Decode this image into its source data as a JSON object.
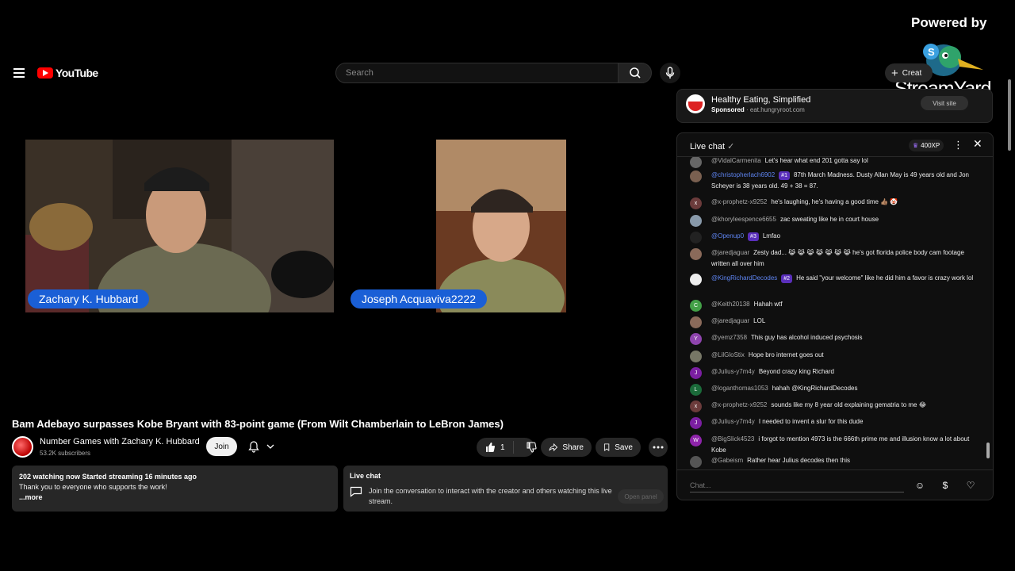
{
  "header": {
    "logo_text": "YouTube",
    "search_placeholder": "Search",
    "create_label": "Creat"
  },
  "overlay": {
    "powered_by": "Powered by",
    "brand": "StreamYard"
  },
  "video": {
    "tiles": [
      {
        "name": "Zachary K. Hubbard"
      },
      {
        "name": "Joseph Acquaviva2222"
      }
    ],
    "title": "Bam Adebayo surpasses Kobe Bryant with 83-point game (From Wilt Chamberlain to LeBron James)",
    "channel": {
      "name": "Number Games with Zachary K. Hubbard",
      "subscribers": "53.2K subscribers"
    },
    "join_label": "Join",
    "like_count": "1",
    "share_label": "Share",
    "save_label": "Save"
  },
  "description": {
    "stats": "202 watching now  Started streaming 16 minutes ago",
    "text": "Thank you to everyone who supports the work!",
    "more": "...more"
  },
  "livechat_promo": {
    "title": "Live chat",
    "message": "Join the conversation to interact with the creator and others watching this live stream.",
    "button": "Open panel"
  },
  "ad": {
    "title": "Healthy Eating, Simplified",
    "sponsored": "Sponsored",
    "domain": "eat.hungryroot.com",
    "visit": "Visit site"
  },
  "chat": {
    "title": "Live chat",
    "xp": "400XP",
    "input_placeholder": "Chat...",
    "messages": [
      {
        "author": "@VidalCarmenita",
        "text": "Let's hear what end 201 gotta say lol",
        "color": "#666666",
        "initial": ""
      },
      {
        "author": "@christopherlach6902",
        "rank": "#1",
        "text": "87th March Madness. Dusty Allan May is 49 years old and Jon Scheyer is 38 years old. 49 + 38 = 87.",
        "color": "#7a6050",
        "initial": "",
        "mod": true
      },
      {
        "author": "@x-prophetz-x9252",
        "text": "he's laughing, he's having a good time 👍🏽 🤡",
        "color": "#6b3b3b",
        "initial": "x"
      },
      {
        "author": "@khoryleespence6655",
        "text": "zac sweating like he in court house",
        "color": "#8899aa",
        "initial": ""
      },
      {
        "author": "@Openup0",
        "rank": "#3",
        "text": "Lmfao",
        "color": "#222222",
        "initial": "",
        "mod": true
      },
      {
        "author": "@jaredjaguar",
        "text": "Zesty dad... 😹 😹 😹 😹 😹 😹 😹 he's got florida police body cam footage written all over him",
        "color": "#8a6a5a",
        "initial": ""
      },
      {
        "author": "@KingRichardDecodes",
        "rank": "#2",
        "text": "He said \"your welcome\" like he did him a favor is crazy work lol",
        "color": "#eeeeee",
        "initial": "",
        "mod": true
      },
      {
        "author": "@Keith20138",
        "text": "Hahah wtf",
        "color": "#43a047",
        "initial": "C"
      },
      {
        "author": "@jaredjaguar",
        "text": "LOL",
        "color": "#8a6a5a",
        "initial": ""
      },
      {
        "author": "@yemz7358",
        "text": "This guy has alcohol induced psychosis",
        "color": "#8e44ad",
        "initial": "Y"
      },
      {
        "author": "@LilGloStix",
        "text": "Hope bro internet goes out",
        "color": "#777766",
        "initial": ""
      },
      {
        "author": "@Julius-y7m4y",
        "text": "Beyond crazy king Richard",
        "color": "#7b1fa2",
        "initial": "J"
      },
      {
        "author": "@loganthomas1053",
        "text": "hahah @KingRichardDecodes",
        "color": "#1b6b3a",
        "initial": "L"
      },
      {
        "author": "@x-prophetz-x9252",
        "text": "sounds like my 8 year old explaining gematria to me 😂",
        "color": "#6b3b3b",
        "initial": "x"
      },
      {
        "author": "@Julius-y7m4y",
        "text": "I needed to invent a slur for this dude",
        "color": "#7b1fa2",
        "initial": "J"
      },
      {
        "author": "@BigSlick4523",
        "text": "i forgot to mention 4973 is the 666th prime me and illusion know a lot about Kobe",
        "color": "#8e24aa",
        "initial": "W"
      },
      {
        "author": "@Gabeism",
        "text": "Rather hear Julius decodes then this",
        "color": "#555555",
        "initial": ""
      }
    ]
  }
}
